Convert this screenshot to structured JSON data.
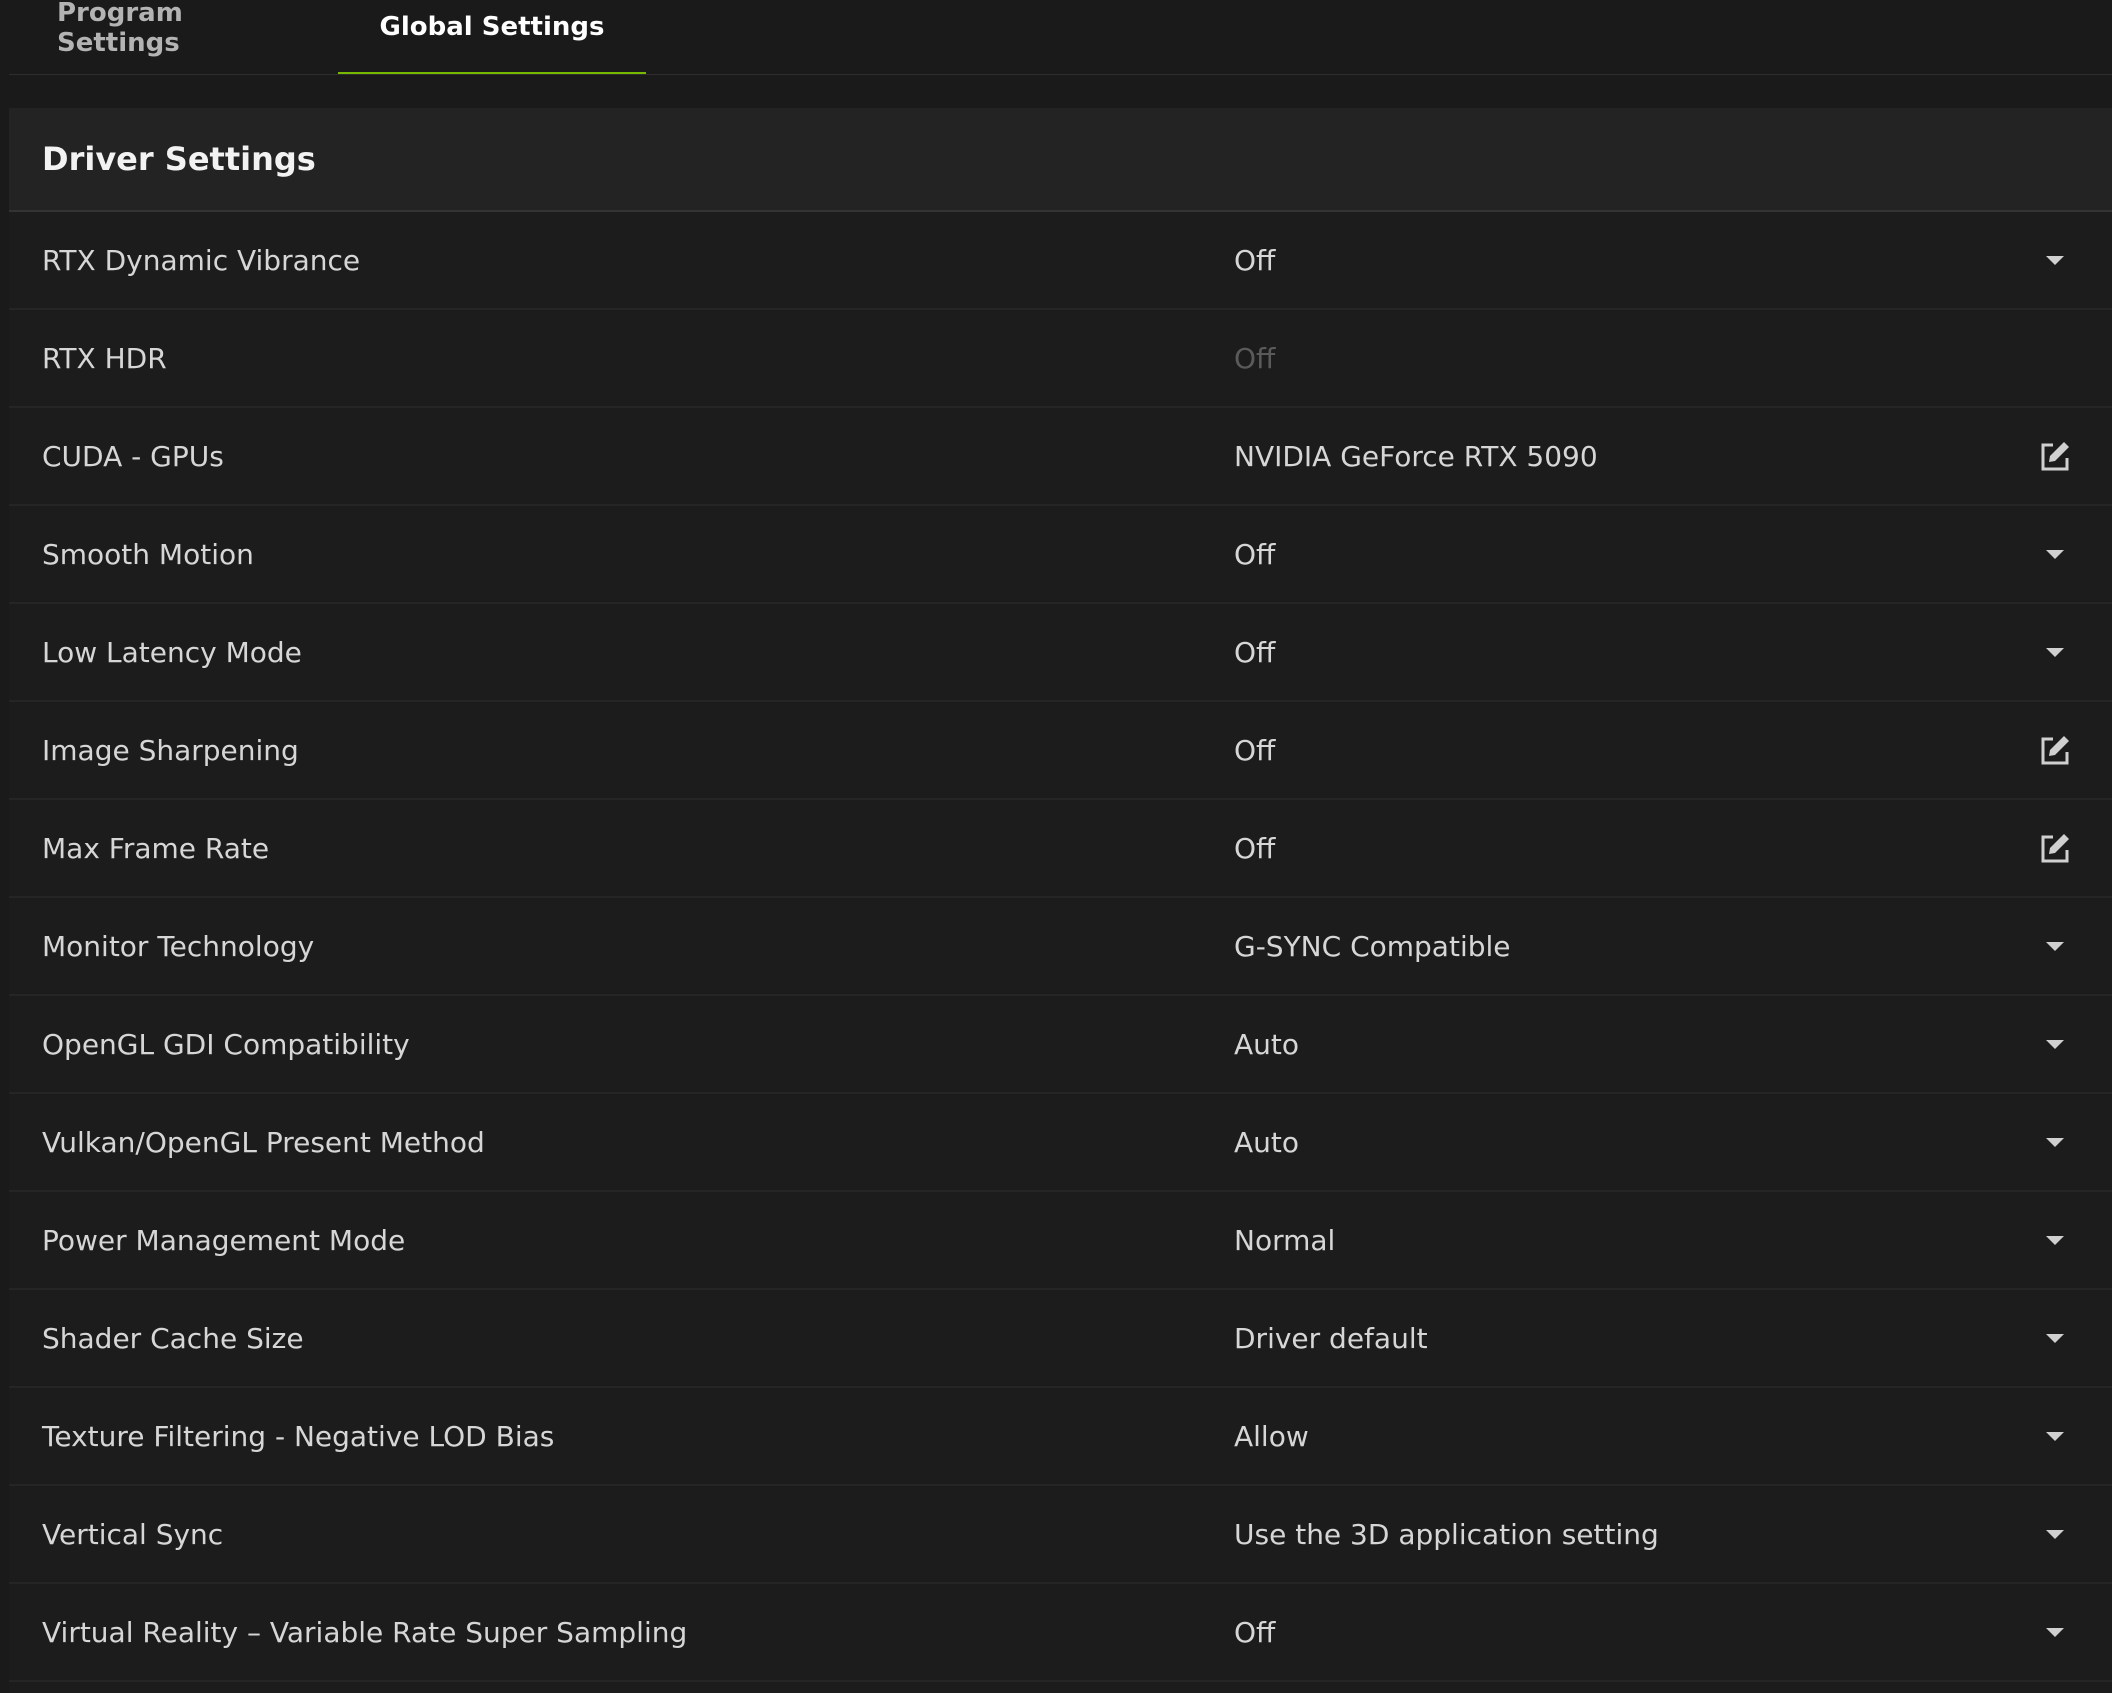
{
  "tabs": [
    {
      "label": "Program Settings",
      "active": false
    },
    {
      "label": "Global Settings",
      "active": true
    }
  ],
  "accent_color": "#76b900",
  "panel": {
    "title": "Driver Settings",
    "rows": [
      {
        "label": "RTX Dynamic Vibrance",
        "value": "Off",
        "control": "dropdown",
        "disabled": false
      },
      {
        "label": "RTX HDR",
        "value": "Off",
        "control": "none",
        "disabled": true
      },
      {
        "label": "CUDA - GPUs",
        "value": "NVIDIA GeForce RTX 5090",
        "control": "edit",
        "disabled": false
      },
      {
        "label": "Smooth Motion",
        "value": "Off",
        "control": "dropdown",
        "disabled": false
      },
      {
        "label": "Low Latency Mode",
        "value": "Off",
        "control": "dropdown",
        "disabled": false
      },
      {
        "label": "Image Sharpening",
        "value": "Off",
        "control": "edit",
        "disabled": false
      },
      {
        "label": "Max Frame Rate",
        "value": "Off",
        "control": "edit",
        "disabled": false
      },
      {
        "label": "Monitor Technology",
        "value": "G-SYNC Compatible",
        "control": "dropdown",
        "disabled": false
      },
      {
        "label": "OpenGL GDI Compatibility",
        "value": "Auto",
        "control": "dropdown",
        "disabled": false
      },
      {
        "label": "Vulkan/OpenGL Present Method",
        "value": "Auto",
        "control": "dropdown",
        "disabled": false
      },
      {
        "label": "Power Management Mode",
        "value": "Normal",
        "control": "dropdown",
        "disabled": false
      },
      {
        "label": "Shader Cache Size",
        "value": "Driver default",
        "control": "dropdown",
        "disabled": false
      },
      {
        "label": "Texture Filtering - Negative LOD Bias",
        "value": "Allow",
        "control": "dropdown",
        "disabled": false
      },
      {
        "label": "Vertical Sync",
        "value": "Use the 3D application setting",
        "control": "dropdown",
        "disabled": false
      },
      {
        "label": "Virtual Reality – Variable Rate Super Sampling",
        "value": "Off",
        "control": "dropdown",
        "disabled": false
      }
    ]
  },
  "icons": {
    "dropdown": "chevron-down-icon",
    "edit": "edit-icon"
  }
}
